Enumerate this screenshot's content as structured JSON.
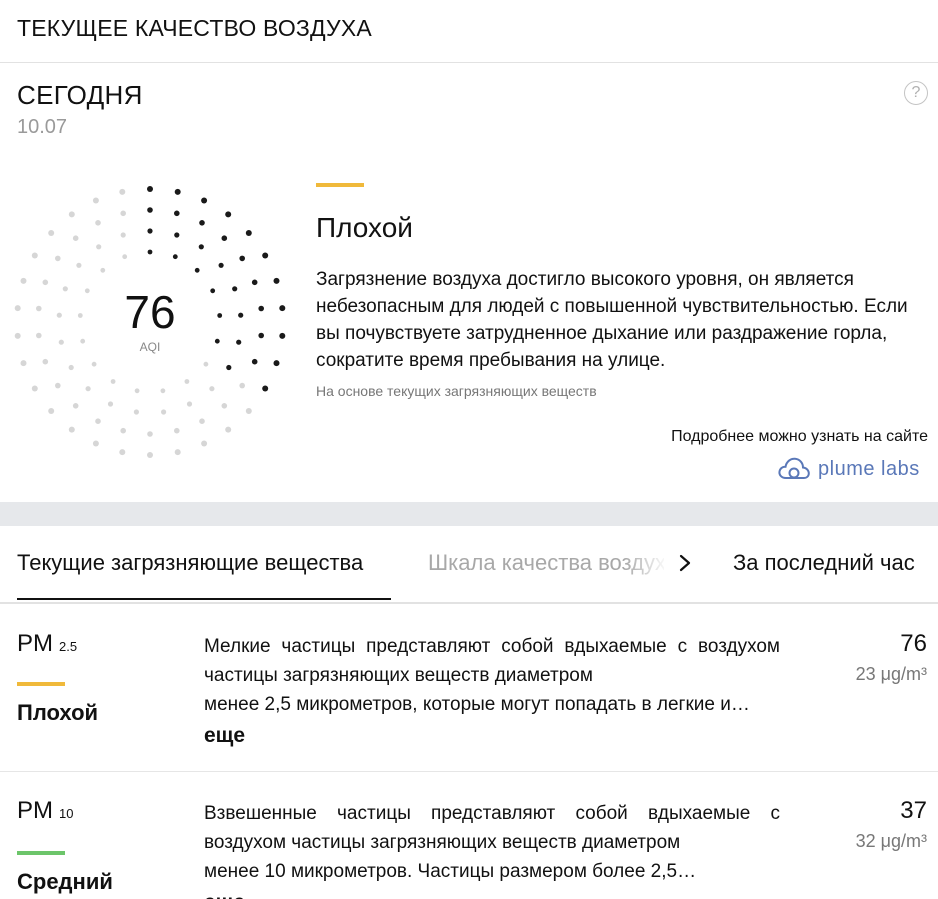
{
  "header": {
    "title": "ТЕКУЩЕЕ КАЧЕСТВО ВОЗДУХА"
  },
  "today": {
    "label": "СЕГОДНЯ",
    "date": "10.07",
    "help_glyph": "?"
  },
  "aqi": {
    "value": "76",
    "unit": "AQI",
    "level": 0.34,
    "status": "Плохой",
    "status_color": "#f0b93a",
    "description": "Загрязнение воздуха достигло высокого уровня, он является небезопасным для людей с повышенной чувствительностью. Если вы почувствуете затрудненное дыхание или раздражение горла, сократите время пребывания на улице.",
    "note": "На основе текущих загрязняющих веществ",
    "more_info": "Подробнее можно узнать на сайте",
    "brand": "plume labs",
    "brand_color": "#5a78b8"
  },
  "tabs": [
    {
      "label": "Текущие загрязняющие вещества",
      "active": true
    },
    {
      "label": "Шкала качества воздуха",
      "active": false
    },
    {
      "label": "За последний час",
      "active": false
    }
  ],
  "pollutants": [
    {
      "name": "PM",
      "sub": "2.5",
      "bar_color": "#f0b93a",
      "level": "Плохой",
      "desc_main": "Мелкие частицы представляют собой вдыхаемые с воздухом частицы загрязняющих веществ диаметром",
      "desc_tail": "менее 2,5 микрометров, которые могут попадать в легкие и…",
      "more": "еще",
      "value": "76",
      "concentration": "23 μg/m³"
    },
    {
      "name": "PM",
      "sub": "10",
      "bar_color": "#6cc56a",
      "level": "Средний",
      "desc_main": "Взвешенные частицы представляют собой вдыхаемые с воздухом частицы загрязняющих веществ диаметром",
      "desc_tail": "менее 10 микрометров. Частицы размером более 2,5…",
      "more": "еще",
      "value": "37",
      "concentration": "32 μg/m³"
    }
  ]
}
